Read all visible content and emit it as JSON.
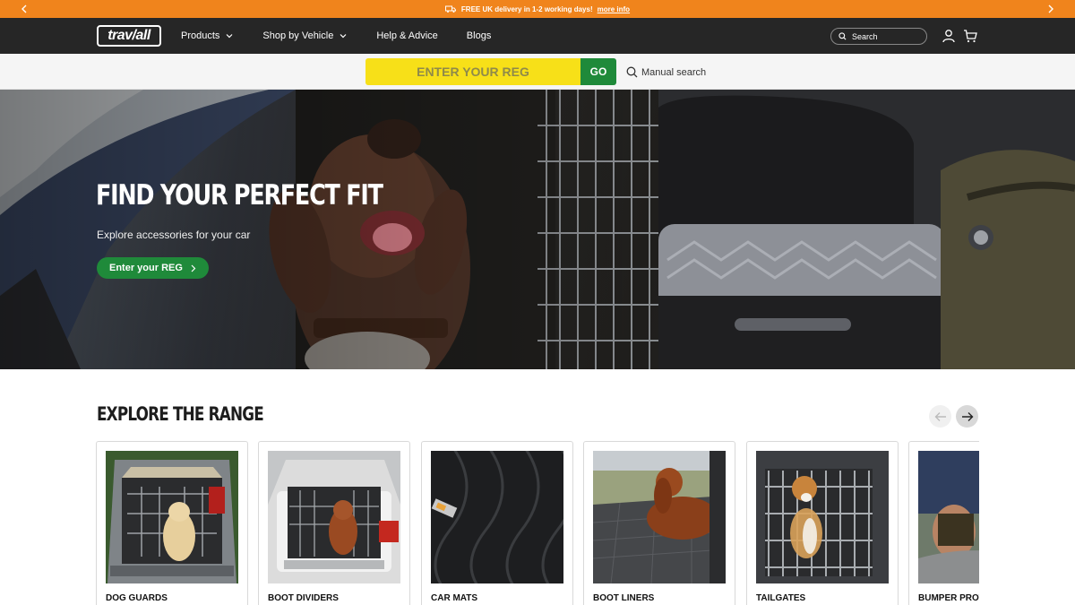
{
  "promo": {
    "text": "FREE UK delivery in 1-2 working days!",
    "link": "more info"
  },
  "header": {
    "logo": "trav/all",
    "nav": [
      {
        "label": "Products",
        "dropdown": true
      },
      {
        "label": "Shop by Vehicle",
        "dropdown": true
      },
      {
        "label": "Help & Advice",
        "dropdown": false
      },
      {
        "label": "Blogs",
        "dropdown": false
      }
    ],
    "search_placeholder": "Search"
  },
  "regbar": {
    "placeholder": "ENTER YOUR REG",
    "go_label": "GO",
    "manual_label": "Manual search"
  },
  "hero": {
    "title": "FIND YOUR PERFECT FIT",
    "subtitle": "Explore accessories for your car",
    "cta": "Enter your REG"
  },
  "range": {
    "title": "EXPLORE THE RANGE",
    "cards": [
      {
        "label": "DOG GUARDS"
      },
      {
        "label": "BOOT DIVIDERS"
      },
      {
        "label": "CAR MATS"
      },
      {
        "label": "BOOT LINERS"
      },
      {
        "label": "TAILGATES"
      },
      {
        "label": "BUMPER PROT"
      }
    ]
  },
  "colors": {
    "promo": "#f0841c",
    "header": "#262626",
    "reg_yellow": "#f7e018",
    "green": "#1f8a3a"
  }
}
